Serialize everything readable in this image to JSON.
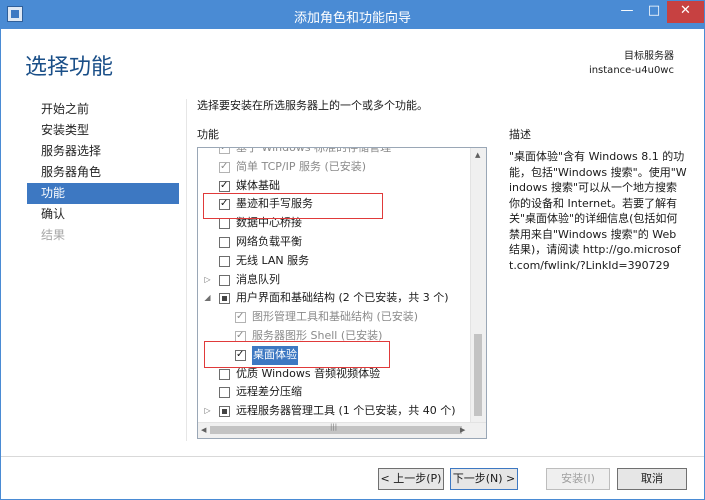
{
  "window": {
    "title": "添加角色和功能向导",
    "min_glyph": "—",
    "max_glyph": "□",
    "close_glyph": "✕"
  },
  "page_title": "选择功能",
  "target": {
    "label": "目标服务器",
    "server": "instance-u4u0wc"
  },
  "nav": {
    "items": [
      {
        "label": "开始之前",
        "state": "normal"
      },
      {
        "label": "安装类型",
        "state": "normal"
      },
      {
        "label": "服务器选择",
        "state": "normal"
      },
      {
        "label": "服务器角色",
        "state": "normal"
      },
      {
        "label": "功能",
        "state": "active"
      },
      {
        "label": "确认",
        "state": "normal"
      },
      {
        "label": "结果",
        "state": "disabled"
      }
    ]
  },
  "main": {
    "instruction": "选择要安装在所选服务器上的一个或多个功能。",
    "features_label": "功能",
    "description_label": "描述",
    "features": [
      {
        "label": "基于 Windows 标准的存储管理",
        "level": 1,
        "state": "checked",
        "expander": "",
        "disabled": true
      },
      {
        "label": "简单 TCP/IP 服务 (已安装)",
        "level": 1,
        "state": "checked",
        "expander": "",
        "disabled": true
      },
      {
        "label": "媒体基础",
        "level": 1,
        "state": "checked",
        "expander": "",
        "disabled": false
      },
      {
        "label": "墨迹和手写服务",
        "level": 1,
        "state": "checked",
        "expander": "",
        "disabled": false
      },
      {
        "label": "数据中心桥接",
        "level": 1,
        "state": "unchecked",
        "expander": "",
        "disabled": false
      },
      {
        "label": "网络负载平衡",
        "level": 1,
        "state": "unchecked",
        "expander": "",
        "disabled": false
      },
      {
        "label": "无线 LAN 服务",
        "level": 1,
        "state": "unchecked",
        "expander": "",
        "disabled": false
      },
      {
        "label": "消息队列",
        "level": 1,
        "state": "unchecked",
        "expander": "▷",
        "disabled": false
      },
      {
        "label": "用户界面和基础结构 (2 个已安装，共 3 个)",
        "level": 1,
        "state": "partial",
        "expander": "◢",
        "disabled": false
      },
      {
        "label": "图形管理工具和基础结构 (已安装)",
        "level": 2,
        "state": "checked",
        "expander": "",
        "disabled": true
      },
      {
        "label": "服务器图形 Shell (已安装)",
        "level": 2,
        "state": "checked",
        "expander": "",
        "disabled": true
      },
      {
        "label": "桌面体验",
        "level": 2,
        "state": "checked",
        "expander": "",
        "disabled": false,
        "selected": true
      },
      {
        "label": "优质 Windows 音频视频体验",
        "level": 1,
        "state": "unchecked",
        "expander": "",
        "disabled": false
      },
      {
        "label": "远程差分压缩",
        "level": 1,
        "state": "unchecked",
        "expander": "",
        "disabled": false
      },
      {
        "label": "远程服务器管理工具 (1 个已安装，共 40 个)",
        "level": 1,
        "state": "partial",
        "expander": "▷",
        "disabled": false
      }
    ],
    "description": "\"桌面体验\"含有 Windows 8.1 的功能，包括\"Windows 搜索\"。使用\"Windows 搜索\"可以从一个地方搜索你的设备和 Internet。若要了解有关\"桌面体验\"的详细信息(包括如何禁用来自\"Windows 搜索\"的 Web 结果)，请阅读 http://go.microsoft.com/fwlink/?LinkId=390729"
  },
  "footer": {
    "prev": "< 上一步(P)",
    "next": "下一步(N) >",
    "install": "安装(I)",
    "cancel": "取消"
  },
  "colors": {
    "titlebar": "#4a8bd4",
    "accent": "#3d78c2",
    "highlight": "#e03a3a",
    "title_text": "#1a4f88"
  }
}
